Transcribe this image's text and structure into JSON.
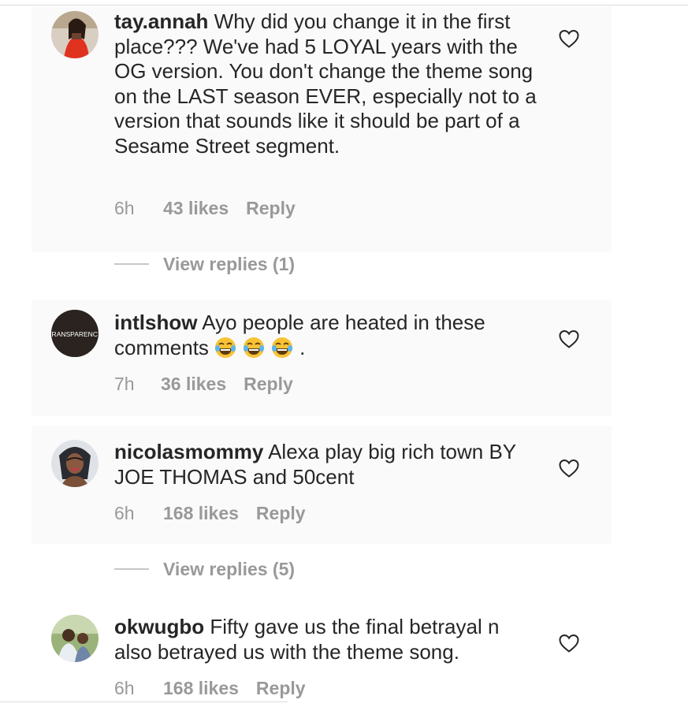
{
  "comments": [
    {
      "username": "tay.annah",
      "text": "Why did you change it in the first place??? We've had 5 LOYAL years with the OG version. You don't change the theme song on the LAST season EVER, especially not to a version that sounds like it should be part of a Sesame Street segment.",
      "time": "6h",
      "likes": "43 likes",
      "reply_label": "Reply",
      "view_replies": "View replies (1)"
    },
    {
      "username": "intlshow",
      "text": "Ayo people are heated in these comments",
      "emoji_tail": ".",
      "avatar_text": "TRANSPARENCY",
      "time": "7h",
      "likes": "36 likes",
      "reply_label": "Reply"
    },
    {
      "username": "nicolasmommy",
      "text": "Alexa play big rich town BY JOE THOMAS and 50cent",
      "time": "6h",
      "likes": "168 likes",
      "reply_label": "Reply",
      "view_replies": "View replies (5)"
    },
    {
      "username": "okwugbo",
      "text": "Fifty gave us the final betrayal n also betrayed us with the theme song.",
      "time": "6h",
      "likes": "168 likes",
      "reply_label": "Reply"
    }
  ],
  "icons": {
    "like": "heart-outline-icon",
    "emoji": "face-with-tears-of-joy"
  },
  "colors": {
    "text": "#262626",
    "meta": "#999999",
    "panel": "#fafafa"
  }
}
